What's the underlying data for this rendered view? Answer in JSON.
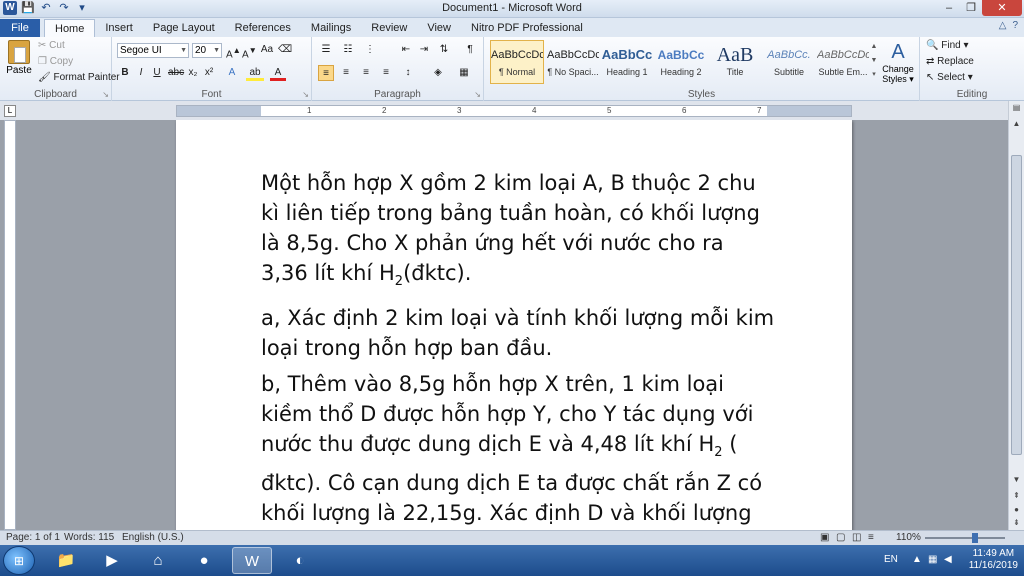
{
  "window": {
    "title": "Document1 - Microsoft Word"
  },
  "qat": {
    "logo": "W",
    "save": "💾",
    "undo": "↶",
    "redo": "↷",
    "customize": "▾"
  },
  "tabs": [
    "File",
    "Home",
    "Insert",
    "Page Layout",
    "References",
    "Mailings",
    "Review",
    "View",
    "Nitro PDF Professional"
  ],
  "ribbon": {
    "clipboard": {
      "paste": "Paste",
      "cut": "Cut",
      "copy": "Copy",
      "format_painter": "Format Painter",
      "label": "Clipboard"
    },
    "font": {
      "name": "Segoe UI",
      "size": "20",
      "label": "Font"
    },
    "paragraph": {
      "label": "Paragraph"
    },
    "styles": {
      "label": "Styles",
      "items": [
        {
          "sample": "AaBbCcDc",
          "name": "¶ Normal"
        },
        {
          "sample": "AaBbCcDc",
          "name": "¶ No Spaci..."
        },
        {
          "sample": "AaBbCc",
          "name": "Heading 1"
        },
        {
          "sample": "AaBbCc",
          "name": "Heading 2"
        },
        {
          "sample": "AaB",
          "name": "Title"
        },
        {
          "sample": "AaBbCc.",
          "name": "Subtitle"
        },
        {
          "sample": "AaBbCcDc",
          "name": "Subtle Em..."
        }
      ],
      "change_styles": "Change Styles ▾"
    },
    "editing": {
      "find": "Find ▾",
      "replace": "Replace",
      "select": "Select ▾",
      "label": "Editing"
    }
  },
  "ruler": {
    "ticks": [
      "1",
      "2",
      "3",
      "4",
      "5",
      "6",
      "7"
    ]
  },
  "document": {
    "p1": "Một hỗn hợp X gồm 2 kim loại A, B thuộc 2 chu kì liên tiếp trong bảng tuần hoàn, có khối lượng là 8,5g. Cho X phản ứng hết với nước cho ra 3,36 lít khí H",
    "p1_sub": "2",
    "p1_end": "(đktc).",
    "p2": "a, Xác định 2 kim loại và tính khối lượng mỗi kim loại trong hỗn hợp ban đầu.",
    "p3_a": "b, Thêm vào 8,5g hỗn hợp X trên, 1 kim loại kiềm thổ D được hỗn hợp Y, cho Y tác dụng với nước thu được dung dịch E và 4,48 lít khí H",
    "p3_sub": "2",
    "p3_b": " ( đktc). Cô cạn dung dịch E ta được chất rắn Z có khối lượng là 22,15g. Xác định D và khối lượng của D."
  },
  "status": {
    "page": "Page: 1 of 1",
    "words": "Words: 115",
    "language": "English (U.S.)",
    "zoom": "110%",
    "zoom_level": 1.1
  },
  "taskbar": {
    "lang": "EN",
    "time": "11:49 AM",
    "date": "11/16/2019"
  },
  "colors": {
    "accent": "#2b579a",
    "file_tab": "#2a5ea8"
  }
}
